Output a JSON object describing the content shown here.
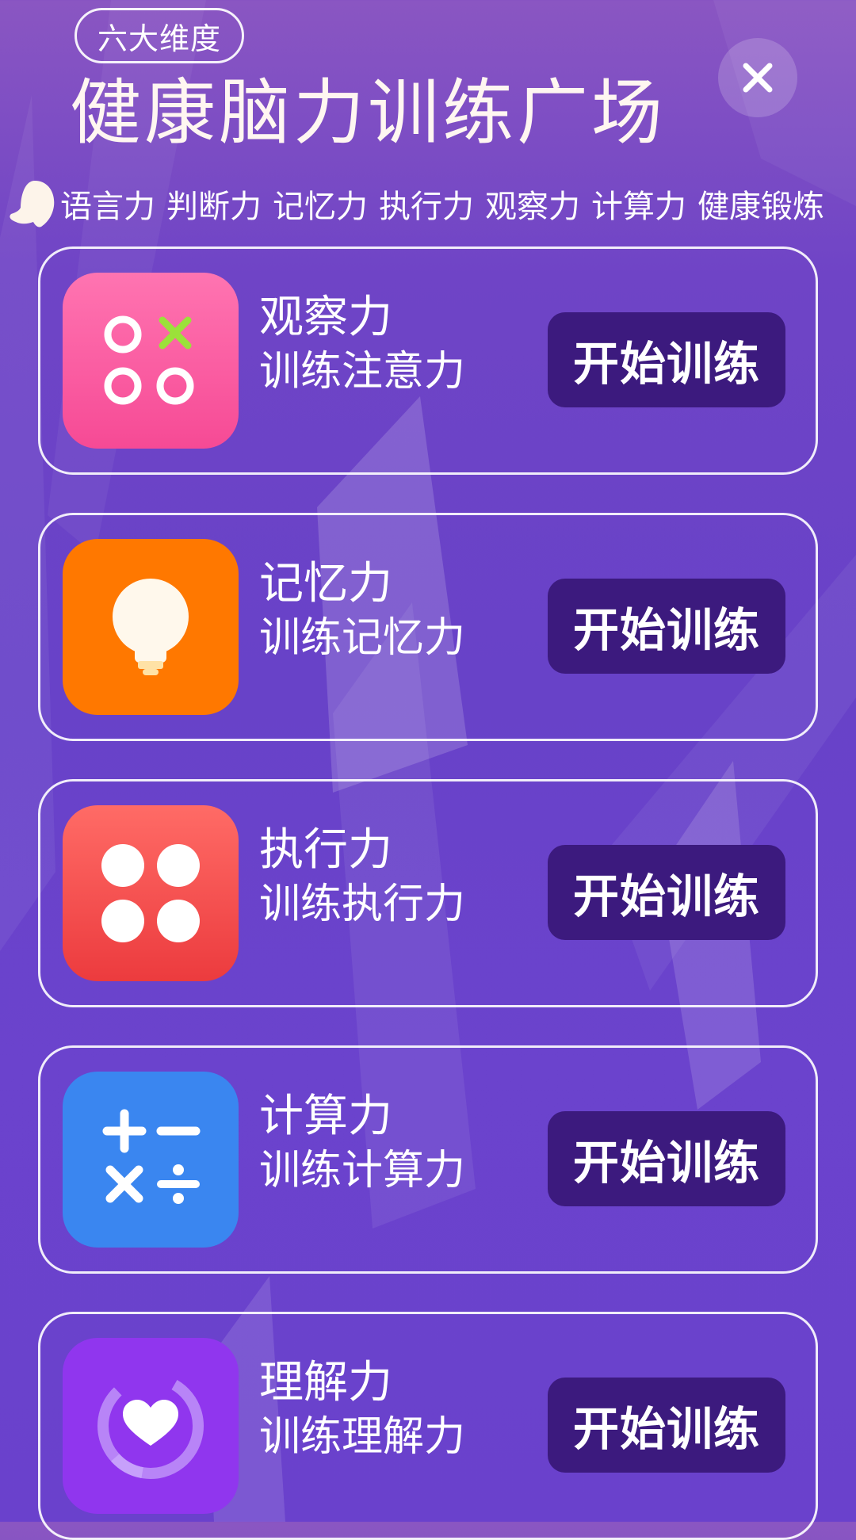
{
  "header": {
    "badge_label": "六大维度",
    "title": "健康脑力训练广场",
    "close_icon": "close-icon"
  },
  "tags": [
    "语言力",
    "判断力",
    "记忆力",
    "执行力",
    "观察力",
    "计算力",
    "健康锻炼"
  ],
  "cards": [
    {
      "title": "观察力",
      "subtitle": "训练注意力",
      "button_label": "开始训练",
      "icon": "observation-icon",
      "icon_color": "#f9559b"
    },
    {
      "title": "记忆力",
      "subtitle": "训练记忆力",
      "button_label": "开始训练",
      "icon": "lightbulb-icon",
      "icon_color": "#ff7a00"
    },
    {
      "title": "执行力",
      "subtitle": "训练执行力",
      "button_label": "开始训练",
      "icon": "dots-grid-icon",
      "icon_color": "#f24a4a"
    },
    {
      "title": "计算力",
      "subtitle": "训练计算力",
      "button_label": "开始训练",
      "icon": "calculator-icon",
      "icon_color": "#3a86f0"
    },
    {
      "title": "理解力",
      "subtitle": "训练理解力",
      "button_label": "开始训练",
      "icon": "heart-icon",
      "icon_color": "#9036ee"
    }
  ],
  "colors": {
    "button_bg": "#3c1a7e",
    "background": "#6a42c9"
  }
}
